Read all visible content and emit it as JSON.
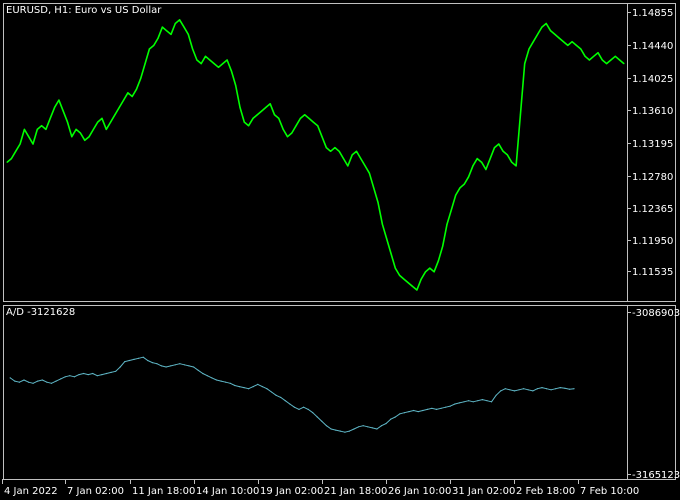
{
  "chart_data": [
    {
      "type": "line",
      "title": "EURUSD, H1:  Euro vs US Dollar",
      "series": [
        {
          "color": "#00ff00",
          "values": [
            1.1285,
            1.129,
            1.13,
            1.131,
            1.133,
            1.132,
            1.131,
            1.133,
            1.1335,
            1.133,
            1.1345,
            1.136,
            1.137,
            1.1355,
            1.134,
            1.132,
            1.133,
            1.1325,
            1.1315,
            1.132,
            1.133,
            1.134,
            1.1345,
            1.133,
            1.134,
            1.135,
            1.136,
            1.137,
            1.138,
            1.1375,
            1.1385,
            1.14,
            1.142,
            1.144,
            1.1445,
            1.1455,
            1.147,
            1.1465,
            1.146,
            1.1475,
            1.148,
            1.147,
            1.146,
            1.144,
            1.1425,
            1.142,
            1.143,
            1.1425,
            1.142,
            1.1415,
            1.142,
            1.1425,
            1.141,
            1.139,
            1.136,
            1.134,
            1.1335,
            1.1345,
            1.135,
            1.1355,
            1.136,
            1.1365,
            1.135,
            1.1345,
            1.133,
            1.132,
            1.1325,
            1.1335,
            1.1345,
            1.135,
            1.1345,
            1.134,
            1.1335,
            1.132,
            1.1305,
            1.13,
            1.1305,
            1.13,
            1.129,
            1.128,
            1.1295,
            1.13,
            1.129,
            1.128,
            1.127,
            1.125,
            1.123,
            1.12,
            1.118,
            1.116,
            1.114,
            1.113,
            1.1125,
            1.112,
            1.1115,
            1.111,
            1.1125,
            1.1135,
            1.114,
            1.1135,
            1.115,
            1.117,
            1.12,
            1.122,
            1.124,
            1.125,
            1.1255,
            1.1265,
            1.128,
            1.129,
            1.1285,
            1.1275,
            1.129,
            1.1305,
            1.131,
            1.13,
            1.1295,
            1.1285,
            1.128,
            1.135,
            1.142,
            1.144,
            1.145,
            1.146,
            1.147,
            1.1475,
            1.1465,
            1.146,
            1.1455,
            1.145,
            1.1445,
            1.145,
            1.1445,
            1.144,
            1.143,
            1.1425,
            1.143,
            1.1435,
            1.1425,
            1.142,
            1.1425,
            1.143,
            1.1425,
            1.142
          ]
        }
      ],
      "ylim": [
        1.1095,
        1.1503
      ],
      "y_ticks": [
        "1.14855",
        "1.14440",
        "1.14025",
        "1.13610",
        "1.13195",
        "1.12780",
        "1.12365",
        "1.11950",
        "1.11535"
      ]
    },
    {
      "type": "line",
      "title": "A/D -3121628",
      "series": [
        {
          "color": "#5fb7c7",
          "values": [
            -3120000,
            -3121500,
            -3122000,
            -3121000,
            -3122000,
            -3122500,
            -3121500,
            -3121000,
            -3122000,
            -3122500,
            -3121500,
            -3120500,
            -3119500,
            -3119000,
            -3119500,
            -3118500,
            -3118000,
            -3118500,
            -3118000,
            -3119000,
            -3118500,
            -3118000,
            -3117500,
            -3117000,
            -3115000,
            -3112500,
            -3112000,
            -3111500,
            -3111000,
            -3110500,
            -3112000,
            -3113000,
            -3113500,
            -3114500,
            -3115000,
            -3114500,
            -3114000,
            -3113500,
            -3114000,
            -3114500,
            -3115000,
            -3116500,
            -3118000,
            -3119000,
            -3120000,
            -3121000,
            -3121500,
            -3122000,
            -3122500,
            -3123500,
            -3124000,
            -3124500,
            -3125000,
            -3124000,
            -3123000,
            -3124000,
            -3125000,
            -3126500,
            -3128000,
            -3129000,
            -3130500,
            -3132000,
            -3133500,
            -3134500,
            -3133500,
            -3134500,
            -3136000,
            -3138000,
            -3140000,
            -3142000,
            -3143500,
            -3144000,
            -3144500,
            -3145000,
            -3144500,
            -3143500,
            -3142500,
            -3142000,
            -3142500,
            -3143000,
            -3143500,
            -3142000,
            -3141000,
            -3139000,
            -3138000,
            -3136500,
            -3136000,
            -3135500,
            -3135000,
            -3135500,
            -3135000,
            -3134500,
            -3134000,
            -3134500,
            -3134000,
            -3133500,
            -3133000,
            -3132000,
            -3131500,
            -3131000,
            -3130500,
            -3131000,
            -3130500,
            -3130000,
            -3130500,
            -3131000,
            -3128000,
            -3126000,
            -3125000,
            -3125500,
            -3126000,
            -3125500,
            -3125000,
            -3125500,
            -3126000,
            -3125000,
            -3124500,
            -3125000,
            -3125500,
            -3125000,
            -3124500,
            -3124800,
            -3125200,
            -3125000
          ],
          "x_span": [
            0.01,
            0.915
          ]
        }
      ],
      "ylim": [
        -3166500,
        -3086500
      ],
      "y_ticks": [
        "-3086903",
        "-3165123"
      ]
    }
  ],
  "x_ticks": [
    "4 Jan 2022",
    "7 Jan 02:00",
    "11 Jan 18:00",
    "14 Jan 10:00",
    "19 Jan 02:00",
    "21 Jan 18:00",
    "26 Jan 10:00",
    "31 Jan 02:00",
    "2 Feb 18:00",
    "7 Feb 10:00"
  ],
  "colors": {
    "background": "#000000",
    "frame": "#c0c0c0",
    "text": "#ffffff"
  }
}
